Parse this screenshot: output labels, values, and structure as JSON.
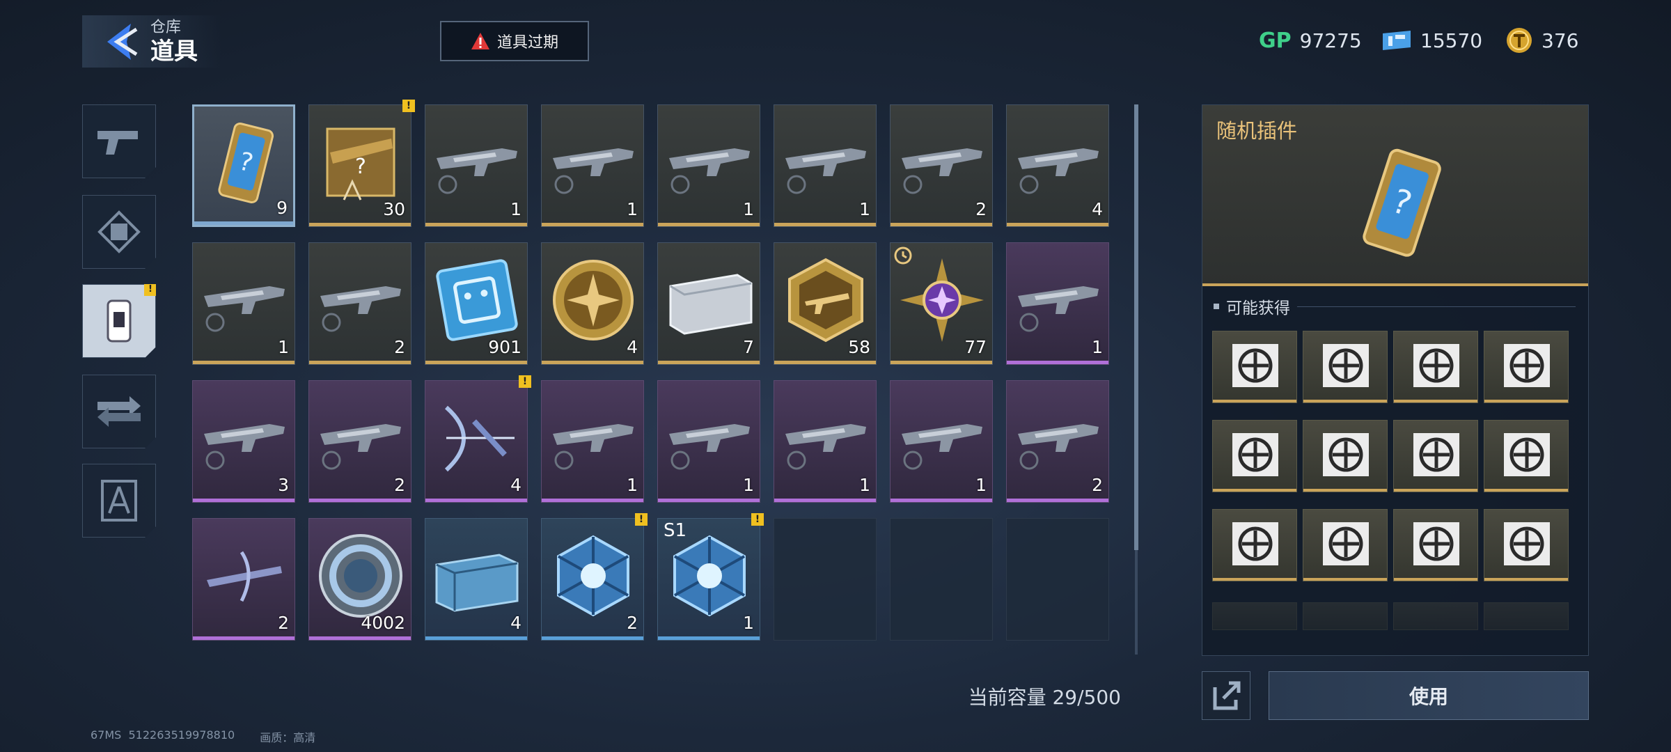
{
  "header": {
    "breadcrumb": "仓库",
    "title": "道具",
    "expire_button": "道具过期"
  },
  "currencies": [
    {
      "label": "GP",
      "value": "97275",
      "icon": "gp-icon"
    },
    {
      "label": "",
      "value": "15570",
      "icon": "ticket-icon"
    },
    {
      "label": "",
      "value": "376",
      "icon": "gold-coin-icon"
    }
  ],
  "sidebar": {
    "items": [
      {
        "icon": "pistol-icon"
      },
      {
        "icon": "skin-frame-icon"
      },
      {
        "icon": "chip-card-icon",
        "active": true
      },
      {
        "icon": "weapon-transfer-icon"
      },
      {
        "icon": "blueprint-icon"
      }
    ]
  },
  "inventory": {
    "items": [
      {
        "qty": "9",
        "rarity": "gold",
        "icon": "random-plugin-card-icon",
        "selected": true
      },
      {
        "qty": "30",
        "rarity": "gold",
        "icon": "weapon-blueprint-box-icon",
        "warn": true
      },
      {
        "qty": "1",
        "rarity": "gold",
        "icon": "rifle-skin-icon"
      },
      {
        "qty": "1",
        "rarity": "gold",
        "icon": "rifle-skin-icon"
      },
      {
        "qty": "1",
        "rarity": "gold",
        "icon": "rifle-skin-icon"
      },
      {
        "qty": "1",
        "rarity": "gold",
        "icon": "rifle-skin-icon"
      },
      {
        "qty": "2",
        "rarity": "gold",
        "icon": "rifle-skin-icon"
      },
      {
        "qty": "4",
        "rarity": "gold",
        "icon": "rifle-skin-icon"
      },
      {
        "qty": "1",
        "rarity": "gold",
        "icon": "rifle-skin-icon"
      },
      {
        "qty": "2",
        "rarity": "gold",
        "icon": "rifle-skin-icon"
      },
      {
        "qty": "901",
        "rarity": "gold",
        "icon": "chip-icon"
      },
      {
        "qty": "4",
        "rarity": "gold",
        "icon": "gold-cross-coin-icon"
      },
      {
        "qty": "7",
        "rarity": "gold",
        "icon": "silver-case-icon"
      },
      {
        "qty": "58",
        "rarity": "gold",
        "icon": "gold-hex-badge-icon"
      },
      {
        "qty": "77",
        "rarity": "gold",
        "icon": "purple-star-emblem-icon",
        "clock": true
      },
      {
        "qty": "1",
        "rarity": "purple",
        "icon": "rifle-skin-icon"
      },
      {
        "qty": "3",
        "rarity": "purple",
        "icon": "rifle-skin-icon"
      },
      {
        "qty": "2",
        "rarity": "purple",
        "icon": "rifle-skin-icon"
      },
      {
        "qty": "4",
        "rarity": "purple",
        "icon": "bow-skin-icon",
        "warn": true
      },
      {
        "qty": "1",
        "rarity": "purple",
        "icon": "rifle-skin-icon"
      },
      {
        "qty": "1",
        "rarity": "purple",
        "icon": "rifle-skin-icon"
      },
      {
        "qty": "1",
        "rarity": "purple",
        "icon": "rifle-skin-icon"
      },
      {
        "qty": "1",
        "rarity": "purple",
        "icon": "rifle-skin-icon"
      },
      {
        "qty": "2",
        "rarity": "purple",
        "icon": "rifle-skin-icon"
      },
      {
        "qty": "2",
        "rarity": "purple",
        "icon": "crossbow-skin-icon"
      },
      {
        "qty": "4002",
        "rarity": "purple",
        "icon": "blue-ring-coin-icon"
      },
      {
        "qty": "4",
        "rarity": "blue",
        "icon": "supply-crate-icon"
      },
      {
        "qty": "2",
        "rarity": "blue",
        "icon": "blue-crystal-box-icon",
        "warn": true
      },
      {
        "qty": "1",
        "rarity": "blue",
        "icon": "blue-crystal-box-icon",
        "warn": true,
        "tag": "S1"
      },
      {
        "qty": "",
        "rarity": "empty"
      },
      {
        "qty": "",
        "rarity": "empty"
      },
      {
        "qty": "",
        "rarity": "empty"
      }
    ],
    "capacity": "当前容量 29/500"
  },
  "detail": {
    "title": "随机插件",
    "possible_label": "可能获得",
    "rewards": [
      {
        "icon": "bullet-wings-plugin-icon"
      },
      {
        "icon": "target-slash-plugin-icon"
      },
      {
        "icon": "arrow-up-plugin-icon"
      },
      {
        "icon": "crosshair-head-plugin-icon"
      },
      {
        "icon": "shield-warning-plugin-icon"
      },
      {
        "icon": "crosshair-ammo-plugin-icon"
      },
      {
        "icon": "rockets-plugin-icon"
      },
      {
        "icon": "gun-ammo-plugin-icon"
      },
      {
        "icon": "reload-plugin-icon"
      },
      {
        "icon": "x-wings-plugin-icon"
      },
      {
        "icon": "bullets-up-plugin-icon"
      },
      {
        "icon": "crosshair-up-plugin-icon"
      }
    ],
    "use_button": "使用"
  },
  "footer": {
    "ping": "67MS",
    "uid": "512263519978810",
    "quality": "画质：高清"
  },
  "colors": {
    "gold": "#caa45a",
    "purple": "#b070d8",
    "blue": "#5aa0d8",
    "title_gold": "#e9c27a",
    "warn": "#f0c020"
  }
}
